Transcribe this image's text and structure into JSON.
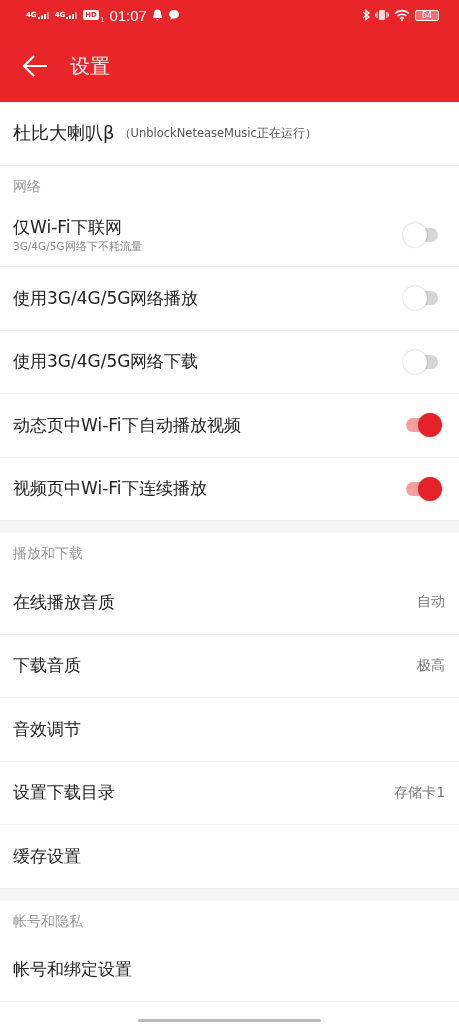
{
  "status_bar": {
    "signals": [
      "4G",
      "4G"
    ],
    "hd": "HD",
    "hd_index": "1",
    "time": "01:07",
    "battery": "64"
  },
  "header": {
    "title": "设置"
  },
  "top_item": {
    "title": "杜比大喇叭β",
    "note": "（UnblockNeteaseMusic正在运行）"
  },
  "sections": [
    {
      "title": "网络",
      "items": [
        {
          "kind": "toggle",
          "label": "仅Wi-Fi下联网",
          "subtitle": "3G/4G/5G网络下不耗流量",
          "on": false
        },
        {
          "kind": "toggle",
          "label": "使用3G/4G/5G网络播放",
          "on": false
        },
        {
          "kind": "toggle",
          "label": "使用3G/4G/5G网络下载",
          "on": false
        },
        {
          "kind": "toggle",
          "label": "动态页中Wi-Fi下自动播放视频",
          "on": true
        },
        {
          "kind": "toggle",
          "label": "视频页中Wi-Fi下连续播放",
          "on": true
        }
      ]
    },
    {
      "title": "播放和下载",
      "items": [
        {
          "kind": "value",
          "label": "在线播放音质",
          "value": "自动"
        },
        {
          "kind": "value",
          "label": "下载音质",
          "value": "极高"
        },
        {
          "kind": "link",
          "label": "音效调节"
        },
        {
          "kind": "value",
          "label": "设置下载目录",
          "value": "存储卡1"
        },
        {
          "kind": "link",
          "label": "缓存设置"
        }
      ]
    },
    {
      "title": "帐号和隐私",
      "items": [
        {
          "kind": "link",
          "label": "帐号和绑定设置"
        }
      ]
    }
  ]
}
